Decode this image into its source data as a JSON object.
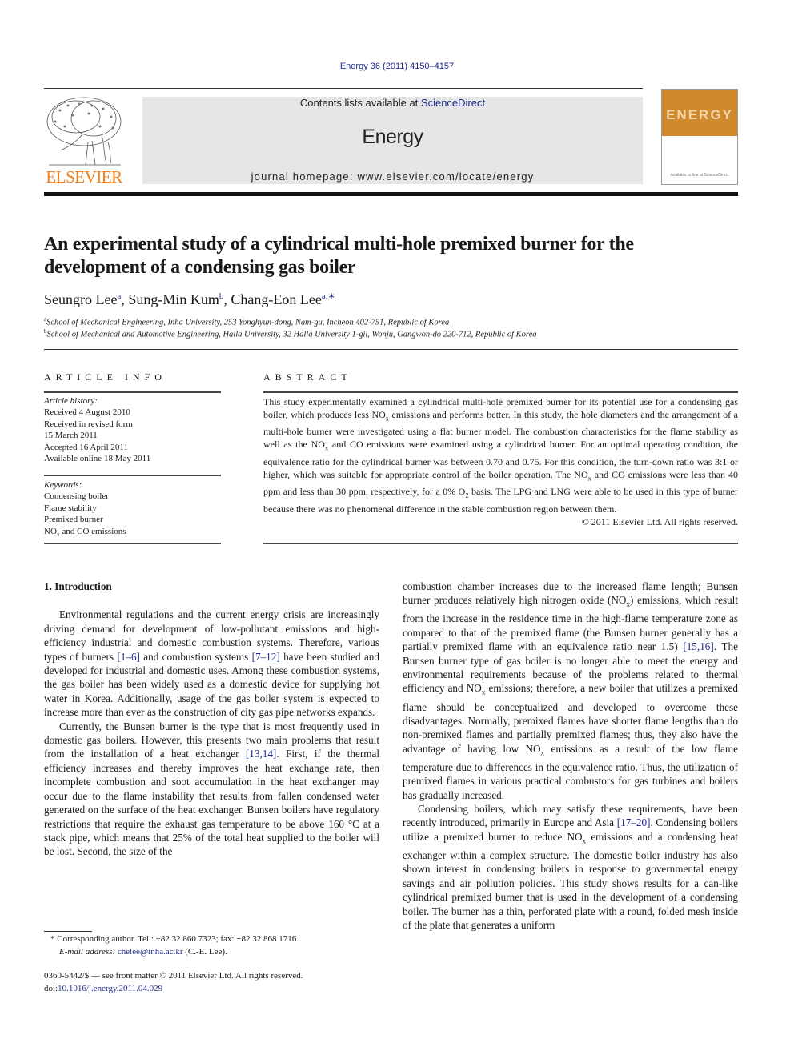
{
  "header": {
    "citation": "Energy 36 (2011) 4150–4157",
    "contents_prefix": "Contents lists available at ",
    "contents_link": "ScienceDirect",
    "journal_title": "Energy",
    "homepage": "journal homepage: www.elsevier.com/locate/energy",
    "publisher_logo_text": "ELSEVIER",
    "cover_title": "ENERGY",
    "cover_footer": "Available online at ScienceDirect"
  },
  "colors": {
    "link": "#1f2d8c",
    "elsevier_orange": "#f07e1a",
    "banner_gray": "#e6e6e6",
    "cover_orange": "#d08a2e"
  },
  "article": {
    "title": "An experimental study of a cylindrical multi-hole premixed burner for the development of a condensing gas boiler",
    "authors": [
      {
        "name": "Seungro Lee",
        "sup": "a"
      },
      {
        "name": "Sung-Min Kum",
        "sup": "b"
      },
      {
        "name": "Chang-Eon Lee",
        "sup": "a,∗"
      }
    ],
    "affiliations": [
      {
        "key": "a",
        "text": "School of Mechanical Engineering, Inha University, 253 Yonghyun-dong, Nam-gu, Incheon 402-751, Republic of Korea"
      },
      {
        "key": "b",
        "text": "School of Mechanical and Automotive Engineering, Halla University, 32 Halla University 1-gil, Wonju, Gangwon-do 220-712, Republic of Korea"
      }
    ]
  },
  "article_info": {
    "heading": "ARTICLE INFO",
    "history_label": "Article history:",
    "history": [
      "Received 4 August 2010",
      "Received in revised form",
      "15 March 2011",
      "Accepted 16 April 2011",
      "Available online 18 May 2011"
    ],
    "keywords_label": "Keywords:",
    "keywords": [
      "Condensing boiler",
      "Flame stability",
      "Premixed burner",
      "NOx and CO emissions"
    ]
  },
  "abstract": {
    "heading": "ABSTRACT",
    "text_1": "This study experimentally examined a cylindrical multi-hole premixed burner for its potential use for a condensing gas boiler, which produces less NO",
    "text_2": " emissions and performs better. In this study, the hole diameters and the arrangement of a multi-hole burner were investigated using a flat burner model. The combustion characteristics for the flame stability as well as the NO",
    "text_3": " and CO emissions were examined using a cylindrical burner. For an optimal operating condition, the equivalence ratio for the cylindrical burner was between 0.70 and 0.75. For this condition, the turn-down ratio was 3:1 or higher, which was suitable for appropriate control of the boiler operation. The NO",
    "text_4": " and CO emissions were less than 40 ppm and less than 30 ppm, respectively, for a 0% O",
    "text_5": " basis. The LPG and LNG were able to be used in this type of burner because there was no phenomenal difference in the stable combustion region between them.",
    "copyright": "© 2011 Elsevier Ltd. All rights reserved."
  },
  "body": {
    "section_heading": "1.  Introduction",
    "p1_a": "Environmental regulations and the current energy crisis are increasingly driving demand for development of low-pollutant emissions and high-efficiency industrial and domestic combustion systems. Therefore, various types of burners ",
    "p1_ref1": "[1–6]",
    "p1_b": " and combustion systems ",
    "p1_ref2": "[7–12]",
    "p1_c": " have been studied and developed for industrial and domestic uses. Among these combustion systems, the gas boiler has been widely used as a domestic device for supplying hot water in Korea. Additionally, usage of the gas boiler system is expected to increase more than ever as the construction of city gas pipe networks expands.",
    "p2_a": "Currently, the Bunsen burner is the type that is most frequently used in domestic gas boilers. However, this presents two main problems that result from the installation of a heat exchanger ",
    "p2_ref1": "[13,14]",
    "p2_b": ". First, if the thermal efficiency increases and thereby improves the heat exchange rate, then incomplete combustion and soot accumulation in the heat exchanger may occur due to the flame instability that results from fallen condensed water generated on the surface of the heat exchanger. Bunsen boilers have regulatory restrictions that require the exhaust gas temperature to be above 160 °C at a stack pipe, which means that 25% of the total heat supplied to the boiler will be lost. Second, the size of the",
    "r1_a": "combustion chamber increases due to the increased flame length; Bunsen burner produces relatively high nitrogen oxide (NO",
    "r1_b": ") emissions, which result from the increase in the residence time in the high-flame temperature zone as compared to that of the premixed flame (the Bunsen burner generally has a partially premixed flame with an equivalence ratio near 1.5) ",
    "r1_ref": "[15,16]",
    "r1_c": ". The Bunsen burner type of gas boiler is no longer able to meet the energy and environmental requirements because of the problems related to thermal efficiency and NO",
    "r1_d": " emissions; therefore, a new boiler that utilizes a premixed flame should be conceptualized and developed to overcome these disadvantages. Normally, premixed flames have shorter flame lengths than do non-premixed flames and partially premixed flames; thus, they also have the advantage of having low NO",
    "r1_e": " emissions as a result of the low flame temperature due to differences in the equivalence ratio. Thus, the utilization of premixed flames in various practical combustors for gas turbines and boilers has gradually increased.",
    "r2_a": "Condensing boilers, which may satisfy these requirements, have been recently introduced, primarily in Europe and Asia ",
    "r2_ref": "[17–20]",
    "r2_b": ". Condensing boilers utilize a premixed burner to reduce NO",
    "r2_c": " emissions and a condensing heat exchanger within a complex structure. The domestic boiler industry has also shown interest in condensing boilers in response to governmental energy savings and air pollution policies. This study shows results for a can-like cylindrical premixed burner that is used in the development of a condensing boiler. The burner has a thin, perforated plate with a round, folded mesh inside of the plate that generates a uniform"
  },
  "footnote": {
    "marker": "*",
    "corresponding": " Corresponding author. Tel.: +82 32 860 7323; fax: +82 32 868 1716.",
    "email_label": "E-mail address: ",
    "email": "chelee@inha.ac.kr",
    "email_suffix": " (C.-E. Lee)."
  },
  "issn": {
    "line": "0360-5442/$ — see front matter © 2011 Elsevier Ltd. All rights reserved.",
    "doi_prefix": "doi:",
    "doi": "10.1016/j.energy.2011.04.029"
  },
  "sub": {
    "x": "x",
    "two": "2"
  }
}
